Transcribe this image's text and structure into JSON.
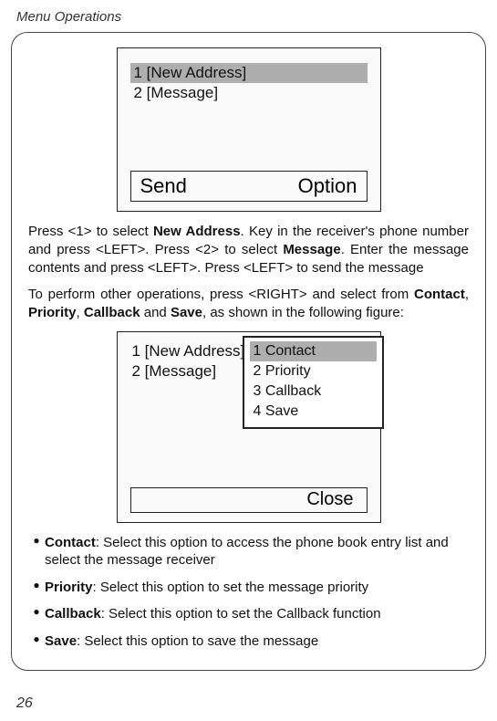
{
  "header": "Menu Operations",
  "page_number": "26",
  "fig1": {
    "items": [
      {
        "label": "1 [New Address]",
        "selected": true
      },
      {
        "label": "2 [Message]",
        "selected": false
      }
    ],
    "soft_left": "Send",
    "soft_right": "Option"
  },
  "para1": {
    "pre1": "Press <1> to select ",
    "b1": "New Address",
    "mid1": ". Key in the receiver's phone number and press <LEFT>. Press <2> to select ",
    "b2": "Message",
    "post1": ". Enter the message contents and press <LEFT>. Press <LEFT> to send the message"
  },
  "para2": {
    "pre": "To perform other operations, press <RIGHT> and select from ",
    "b1": "Contact",
    "c1": ", ",
    "b2": "Priority",
    "c2": ", ",
    "b3": "Callback",
    "c3": " and ",
    "b4": "Save",
    "post": ", as shown in the following figure:"
  },
  "fig2": {
    "bg_items": [
      "1 [New Address]",
      "2 [Message]"
    ],
    "popup_items": [
      {
        "label": "1 Contact",
        "selected": true
      },
      {
        "label": "2 Priority",
        "selected": false
      },
      {
        "label": "3 Callback",
        "selected": false
      },
      {
        "label": "4 Save",
        "selected": false
      }
    ],
    "soft_right": "Close"
  },
  "bullets": [
    {
      "title": "Contact",
      "text": ": Select this option to access the phone book entry list and select the message receiver"
    },
    {
      "title": "Priority",
      "text": ": Select this option to set the message priority"
    },
    {
      "title": "Callback",
      "text": ": Select this option to set the Callback function"
    },
    {
      "title": "Save",
      "text": ": Select this option to save the message"
    }
  ]
}
